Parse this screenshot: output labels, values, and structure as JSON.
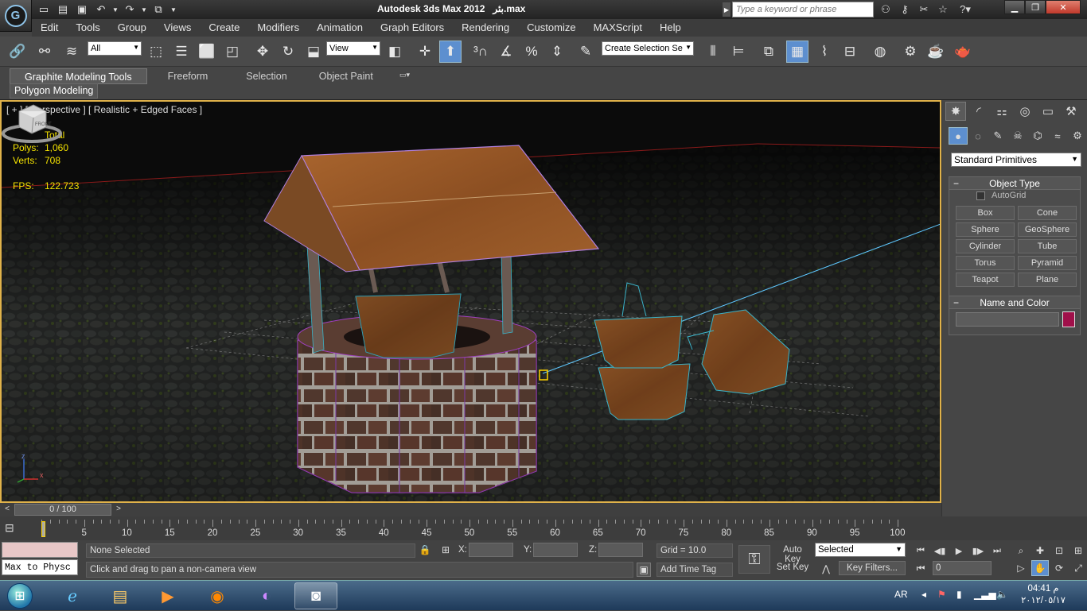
{
  "app": {
    "name": "Autodesk 3ds Max  2012",
    "file": "بئر.max",
    "logo_letter": "G"
  },
  "search": {
    "placeholder": "Type a keyword or phrase"
  },
  "menu": [
    "Edit",
    "Tools",
    "Group",
    "Views",
    "Create",
    "Modifiers",
    "Animation",
    "Graph Editors",
    "Rendering",
    "Customize",
    "MAXScript",
    "Help"
  ],
  "toolbar": {
    "selection_filter": "All",
    "ref_coord": "View",
    "named_selection": "Create Selection Se"
  },
  "ribbon": {
    "tabs": [
      "Graphite Modeling Tools",
      "Freeform",
      "Selection",
      "Object Paint"
    ],
    "panel": "Polygon Modeling"
  },
  "viewport": {
    "label": "[ + ] [ Perspective ] [ Realistic + Edged Faces ]",
    "stats": {
      "header": "Total",
      "polys_label": "Polys:",
      "polys": "1,060",
      "verts_label": "Verts:",
      "verts": "708",
      "fps_label": "FPS:",
      "fps": "122.723"
    },
    "viewcube_label": "FRONT",
    "axis_x": "x",
    "axis_z": "z"
  },
  "command_panel": {
    "category": "Standard Primitives",
    "object_type_title": "Object Type",
    "autogrid": "AutoGrid",
    "buttons": [
      "Box",
      "Cone",
      "Sphere",
      "GeoSphere",
      "Cylinder",
      "Tube",
      "Torus",
      "Pyramid",
      "Teapot",
      "Plane"
    ],
    "name_color_title": "Name and Color",
    "object_color": "#a0104a"
  },
  "time": {
    "slider_label": "0 / 100",
    "ticks": [
      "5",
      "10",
      "15",
      "20",
      "25",
      "30",
      "35",
      "40",
      "45",
      "50",
      "55",
      "60",
      "65",
      "70",
      "75",
      "80",
      "85",
      "90",
      "95",
      "100"
    ]
  },
  "status": {
    "maxscript": "Max to Physc",
    "selection": "None Selected",
    "prompt": "Click and drag to pan a non-camera view",
    "x_label": "X:",
    "y_label": "Y:",
    "z_label": "Z:",
    "grid": "Grid = 10.0",
    "add_time_tag": "Add Time Tag",
    "auto_key": "Auto Key",
    "set_key": "Set Key",
    "key_mode": "Selected",
    "key_filters": "Key Filters...",
    "frame": "0"
  },
  "taskbar": {
    "lang": "AR",
    "time": "04:41 م",
    "date": "٢٠١٢/٠٥/١٧"
  }
}
